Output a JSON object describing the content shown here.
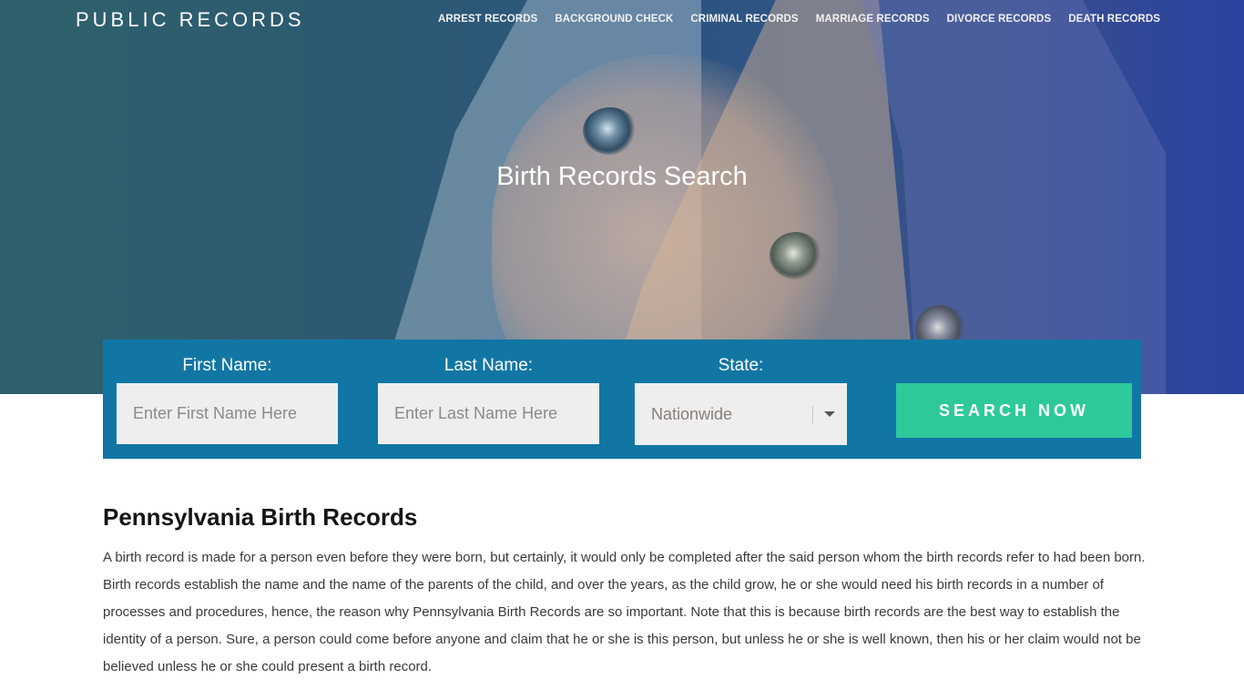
{
  "header": {
    "brand": "PUBLIC RECORDS",
    "nav": [
      {
        "label": "ARREST RECORDS"
      },
      {
        "label": "BACKGROUND CHECK"
      },
      {
        "label": "CRIMINAL RECORDS"
      },
      {
        "label": "MARRIAGE RECORDS"
      },
      {
        "label": "DIVORCE RECORDS"
      },
      {
        "label": "DEATH RECORDS"
      }
    ]
  },
  "hero": {
    "title": "Birth Records Search"
  },
  "search": {
    "first_name_label": "First Name:",
    "first_name_placeholder": "Enter First Name Here",
    "first_name_value": "",
    "last_name_label": "Last Name:",
    "last_name_placeholder": "Enter Last Name Here",
    "last_name_value": "",
    "state_label": "State:",
    "state_selected": "Nationwide",
    "button_label": "SEARCH NOW"
  },
  "content": {
    "heading": "Pennsylvania Birth Records",
    "paragraph": "A birth record is made for a person even before they were born, but certainly, it would only be completed after the said person whom the birth records refer to had been born. Birth records establish the name and the name of the parents of the child, and over the years, as the child grow, he or she would need his birth records in a number of processes and procedures, hence, the reason why Pennsylvania Birth Records are so important. Note that this is because birth records are the best way to establish the identity of a person. Sure, a person could come before anyone and claim that he or she is this person, but unless he or she is well known, then his or her claim would not be believed unless he or she could present a birth record."
  },
  "colors": {
    "search_panel": "#1276a4",
    "search_button": "#2ec99a",
    "input_bg": "#eeeeee"
  }
}
